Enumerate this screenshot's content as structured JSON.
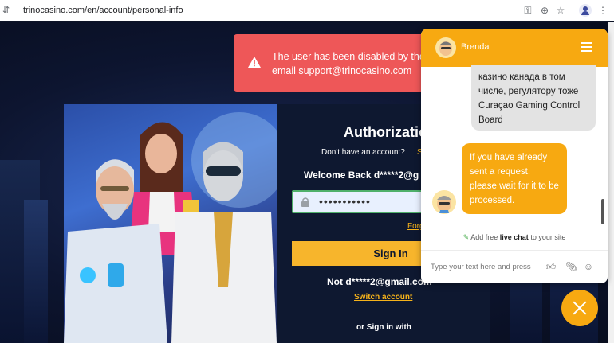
{
  "browser": {
    "url": "trinocasino.com/en/account/personal-info"
  },
  "toast": {
    "message_line1": "The user has been disabled by the",
    "message_line2": "email support@trinocasino.com"
  },
  "auth": {
    "title": "Authorization",
    "no_account_text": "Don't have an account?",
    "signup_link": "S",
    "welcome": "Welcome Back d*****2@g",
    "password_value": "•••••••••••",
    "forgot_link": "Forg",
    "signin_label": "Sign In",
    "not_user": "Not d*****2@gmail.com",
    "switch_account": "Switch account",
    "or_sign_in_with": "or Sign in with"
  },
  "chat": {
    "agent_name": "Brenda",
    "messages": [
      "казино канада в том числе, регулятору тоже Curaçao Gaming Control Board",
      "If you have already sent a request, please wait for it to be processed."
    ],
    "promo_prefix": "Add free",
    "promo_bold": "live chat",
    "promo_suffix": "to your site",
    "input_placeholder": "Type your text here and press"
  },
  "colors": {
    "accent": "#f7a911",
    "toast": "#ee5758",
    "form_bg": "#0e1830",
    "link": "#f5b21b"
  }
}
